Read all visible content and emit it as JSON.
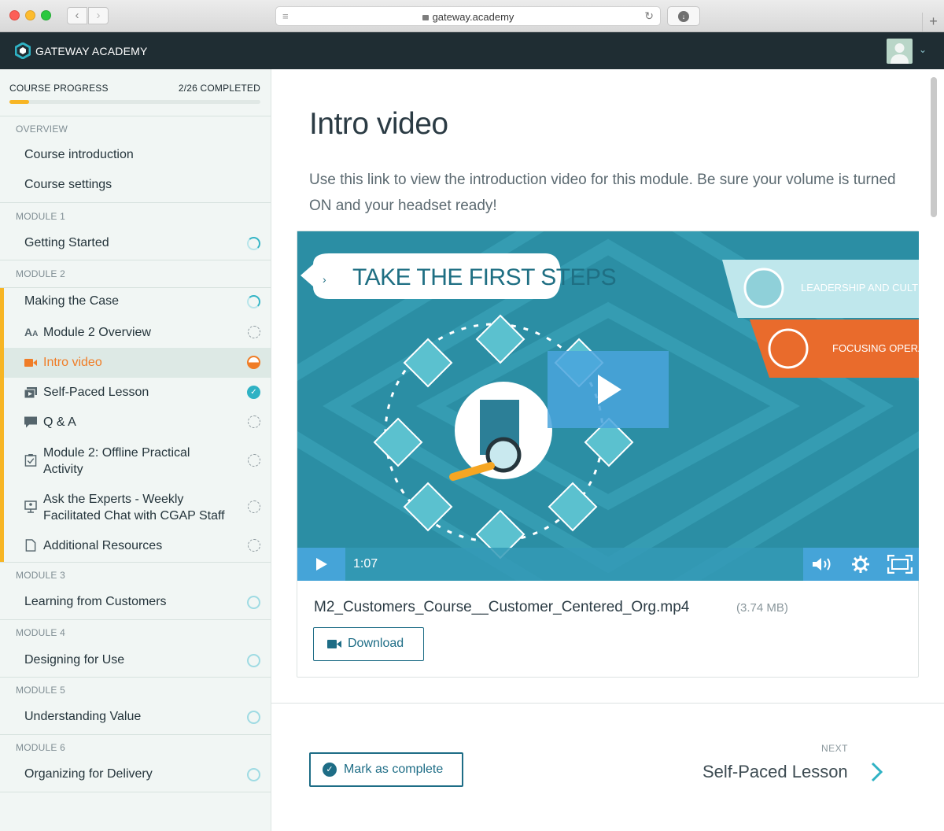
{
  "browser": {
    "url": "gateway.academy"
  },
  "app": {
    "brand": "GATEWAY ACADEMY"
  },
  "sidebar": {
    "progress_label": "COURSE PROGRESS",
    "progress_count": "2/26 COMPLETED",
    "progress_fraction": 0.077,
    "sections": [
      {
        "heading": "OVERVIEW",
        "items": [
          "Course introduction",
          "Course settings"
        ]
      },
      {
        "heading": "MODULE 1",
        "items": [
          "Getting Started"
        ]
      },
      {
        "heading": "MODULE 2",
        "items": [
          "Making the Case",
          "Module 2 Overview",
          "Intro video",
          "Self-Paced Lesson",
          "Q & A",
          "Module 2: Offline Practical Activity",
          "Ask the Experts - Weekly Facilitated Chat with CGAP Staff",
          "Additional Resources"
        ]
      },
      {
        "heading": "MODULE 3",
        "items": [
          "Learning from Customers"
        ]
      },
      {
        "heading": "MODULE 4",
        "items": [
          "Designing for Use"
        ]
      },
      {
        "heading": "MODULE 5",
        "items": [
          "Understanding Value"
        ]
      },
      {
        "heading": "MODULE 6",
        "items": [
          "Organizing for Delivery"
        ]
      }
    ]
  },
  "main": {
    "title": "Intro video",
    "description": "Use this link to view the introduction video for this module. Be sure your volume is turned ON and your headset ready!",
    "video": {
      "banner_text": "TAKE THE FIRST STEPS",
      "tag_1": "LEADERSHIP AND CULTURE",
      "tag_2": "FOCUSING OPERATIO",
      "time": "1:07"
    },
    "file_name": "M2_Customers_Course__Customer_Centered_Org.mp4",
    "file_size": "(3.74 MB)",
    "download_label": "Download",
    "complete_label": "Mark as complete",
    "next_kicker": "NEXT",
    "next_title": "Self-Paced Lesson"
  },
  "colors": {
    "accent": "#1e6d86",
    "progress": "#f7b524",
    "active": "#f07d27",
    "status": "#2fb2c4",
    "header": "#1f2d33"
  }
}
